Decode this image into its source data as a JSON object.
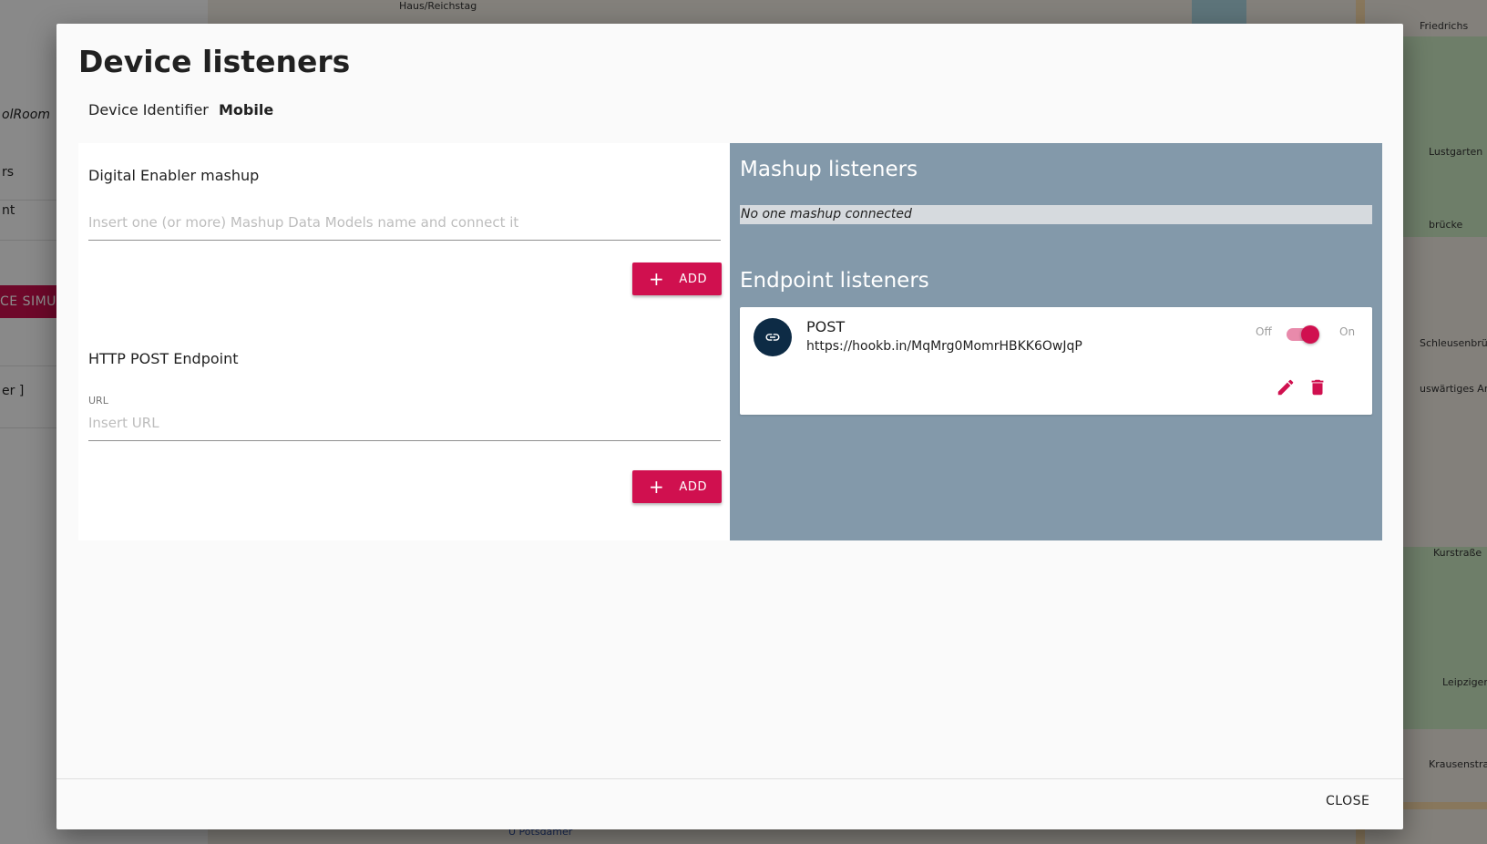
{
  "background": {
    "sidebar": {
      "items": [
        "olRoom",
        "rs",
        "nt",
        "er ]"
      ],
      "simulate_button": "CE SIMUL"
    },
    "map_labels": [
      "Haus/Reichstag",
      "Friedrichs",
      "Lustgarten",
      "brücke",
      "Schleusenbrück",
      "uswärtiges Amt",
      "Kurstraße",
      "Leipziger",
      "Krausenstraße",
      "U Potsdamer"
    ]
  },
  "dialog": {
    "title": "Device listeners",
    "device_identifier_label": "Device Identifier",
    "device_identifier_value": "Mobile",
    "left": {
      "mashup_section_label": "Digital Enabler mashup",
      "mashup_placeholder": "Insert one (or more) Mashup Data Models name and connect it",
      "add_label": "ADD",
      "http_section_label": "HTTP POST Endpoint",
      "url_label": "URL",
      "url_placeholder": "Insert URL",
      "add_label_2": "ADD"
    },
    "right": {
      "mashup_listeners_title": "Mashup listeners",
      "no_mashup_text": "No one mashup connected",
      "endpoint_listeners_title": "Endpoint listeners",
      "endpoint": {
        "method": "POST",
        "url": "https://hookb.in/MqMrg0MomrHBKK6OwJqP",
        "toggle_off_label": "Off",
        "toggle_on_label": "On",
        "enabled": true,
        "icon": "link-icon"
      }
    },
    "close_label": "CLOSE"
  },
  "colors": {
    "accent": "#d0104f",
    "right_panel_bg": "#8399aa",
    "avatar_bg": "#0d2b45"
  }
}
